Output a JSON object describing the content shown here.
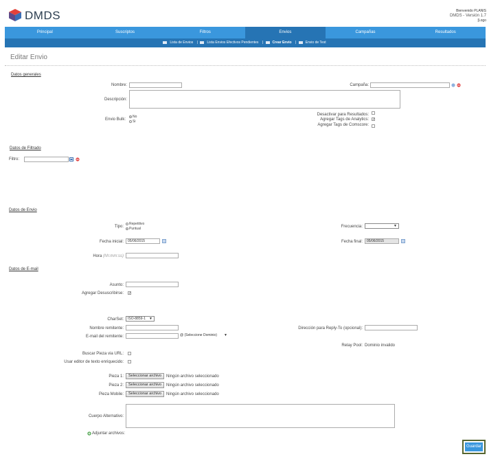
{
  "header": {
    "logo_text": "DMDS",
    "welcome": "Bienvenido PLANIS",
    "version": "DMDS - Versión 1.7",
    "logout": "[Logo"
  },
  "nav": {
    "items": [
      "Principal",
      "Suscriptos",
      "Filtros",
      "Envios",
      "Campañas",
      "Resultados"
    ],
    "active": "Envios"
  },
  "subnav": {
    "items": [
      "Lista de Envios",
      "Lista Envios Efectivos Pendientes",
      "Crear Envio",
      "Envio de Test"
    ],
    "active": "Crear Envio"
  },
  "page_title": "Editar Envio",
  "datos_generales": {
    "section": "Datos generales",
    "nombre_label": "Nombre:",
    "nombre_value": "",
    "campana_label": "Campaña:",
    "campana_value": "",
    "descripcion_label": "Descripción:",
    "envio_bulk_label": "Envio Bulk:",
    "bulk_no": "No",
    "bulk_si": "Si",
    "desactivar_label": "Desactivar para Resultados:",
    "analytics_label": "Agregar Tags de Analytics:",
    "comscore_label": "Agregar Tags de Comscore:"
  },
  "datos_filtrado": {
    "section": "Datos de Filtrado",
    "filtro_label": "Filtro:"
  },
  "datos_envio": {
    "section": "Datos de Envio",
    "tipo_label": "Tipo:",
    "tipo_repetitivo": "Repetitivo",
    "tipo_puntual": "Puntual",
    "frecuencia_label": "Frecuencia:",
    "fecha_inicial_label": "Fecha inicial:",
    "fecha_inicial_value": "05/06/2015",
    "fecha_final_label": "Fecha final:",
    "fecha_final_value": "05/06/2015",
    "hora_label": "Hora",
    "hora_hint": "(hh:mm:ss)"
  },
  "datos_email": {
    "section": "Datos de E-mail",
    "asunto_label": "Asunto:",
    "desuscribirse_label": "Agregar Desuscribirse:",
    "charset_label": "CharSet:",
    "charset_value": "ISO-8859-1",
    "nombre_remitente_label": "Nombre remitente:",
    "replyto_label": "Dirección para Reply-To (opcional):",
    "email_remitente_label": "E-mail del remitente:",
    "dominio_value": "@ (Seleccione Dominio)",
    "relay_pool_label": "Relay Pool:",
    "relay_pool_value": "Dominio invalido",
    "buscar_pieza_label": "Buscar Pieza via URL:",
    "editor_label": "Usar editor de texto enriquecido:",
    "pieza1_label": "Pieza 1:",
    "pieza2_label": "Pieza 2:",
    "pieza_mobile_label": "Pieza Mobile:",
    "file_button": "Seleccionar archivo",
    "no_file": "Ningún archivo seleccionado",
    "cuerpo_label": "Cuerpo Alternativo:",
    "adjuntar_label": "Adjuntar archivos:"
  },
  "save_button": "Guardar",
  "colors": {
    "nav": "#3a97dd",
    "nav_active": "#2674b4",
    "accent_border": "#56652f"
  }
}
